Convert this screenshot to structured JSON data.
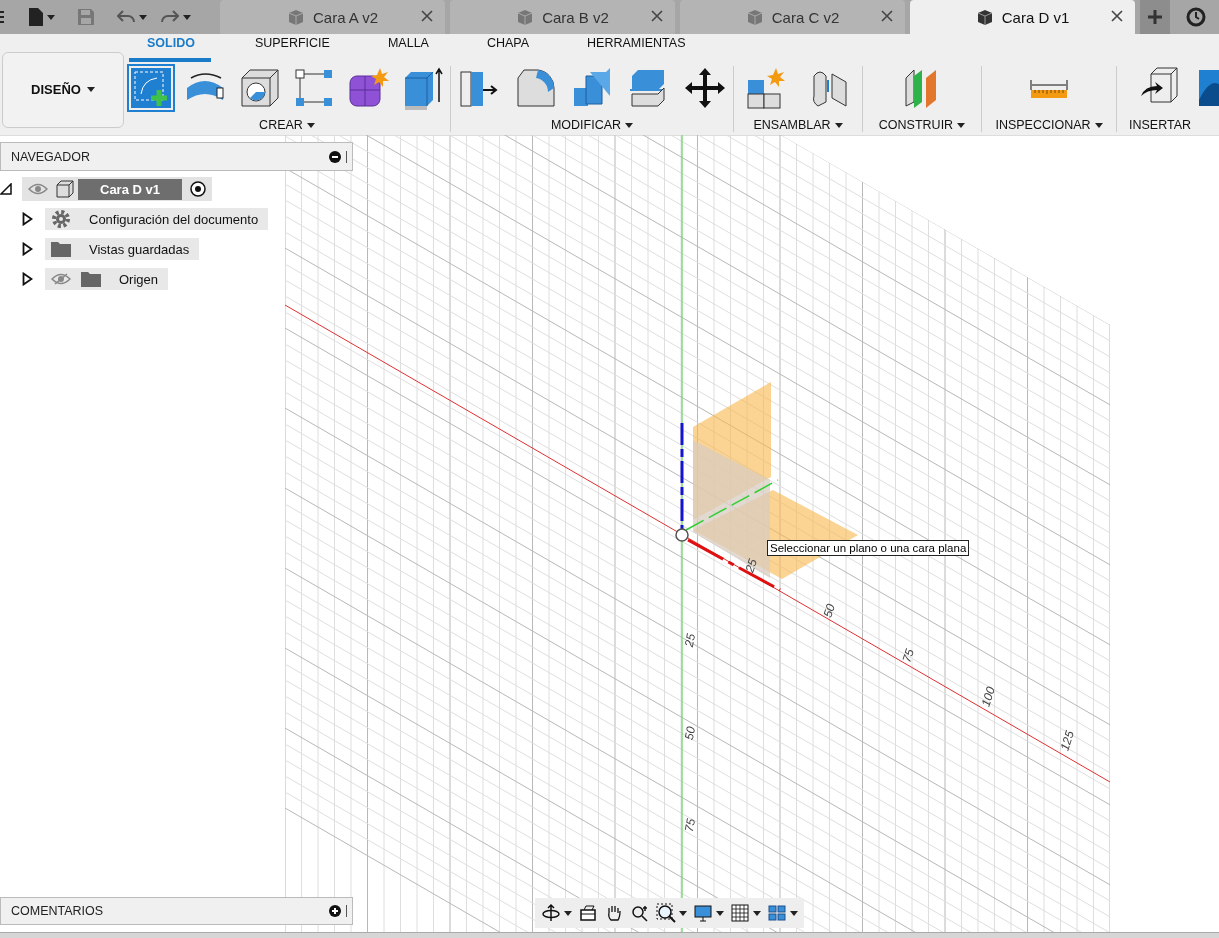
{
  "document_tabs": [
    {
      "title": "Cara A v2",
      "selected": false
    },
    {
      "title": "Cara B v2",
      "selected": false
    },
    {
      "title": "Cara C v2",
      "selected": false
    },
    {
      "title": "Cara D v1",
      "selected": true
    }
  ],
  "workspace_button": {
    "label": "DISEÑO"
  },
  "ribbon_tabs": [
    {
      "label": "SOLIDO",
      "selected": true
    },
    {
      "label": "SUPERFICIE",
      "selected": false
    },
    {
      "label": "MALLA",
      "selected": false
    },
    {
      "label": "CHAPA",
      "selected": false
    },
    {
      "label": "HERRAMIENTAS",
      "selected": false
    }
  ],
  "tool_groups": [
    {
      "label": "CREAR",
      "tools": [
        {
          "kind": "sketch",
          "selected": true
        },
        {
          "kind": "revolve",
          "selected": false
        },
        {
          "kind": "hole",
          "selected": false
        },
        {
          "kind": "pattern",
          "selected": false
        },
        {
          "kind": "form",
          "selected": false
        },
        {
          "kind": "extrude",
          "selected": false
        }
      ]
    },
    {
      "label": "MODIFICAR",
      "tools": [
        {
          "kind": "presspull",
          "selected": false
        },
        {
          "kind": "fillet",
          "selected": false
        },
        {
          "kind": "combine",
          "selected": false
        },
        {
          "kind": "split",
          "selected": false
        },
        {
          "kind": "move",
          "selected": false
        }
      ]
    },
    {
      "label": "ENSAMBLAR",
      "tools": [
        {
          "kind": "component",
          "selected": false
        },
        {
          "kind": "joint",
          "selected": false
        }
      ]
    },
    {
      "label": "CONSTRUIR",
      "tools": [
        {
          "kind": "plane",
          "selected": false
        }
      ]
    },
    {
      "label": "INSPECCIONAR",
      "tools": [
        {
          "kind": "measure",
          "selected": false
        }
      ]
    },
    {
      "label": "INSERTAR",
      "tools": [
        {
          "kind": "insert",
          "selected": false
        },
        {
          "kind": "canvas",
          "selected": false
        }
      ]
    }
  ],
  "navigator": {
    "title": "NAVEGADOR",
    "root": {
      "label": "Cara D v1",
      "expanded": true,
      "visible": true,
      "children": [
        {
          "label": "Configuración del documento",
          "kind": "settings",
          "expanded": false
        },
        {
          "label": "Vistas guardadas",
          "kind": "folder",
          "expanded": false
        },
        {
          "label": "Origen",
          "kind": "folder",
          "expanded": false,
          "visible": false
        }
      ]
    }
  },
  "viewport": {
    "x_axis_labels": [
      "25",
      "50",
      "75",
      "100",
      "125"
    ],
    "y_axis_labels": [
      "25",
      "50",
      "75"
    ],
    "tooltip": "Seleccionar un plano o una cara plana"
  },
  "comments_panel": {
    "title": "COMENTARIOS"
  },
  "view_toolbar": [
    {
      "kind": "orbit",
      "menu": true
    },
    {
      "kind": "look",
      "menu": false
    },
    {
      "kind": "pan",
      "menu": false
    },
    {
      "kind": "zoom",
      "menu": false
    },
    {
      "kind": "fit",
      "menu": true
    },
    {
      "kind": "display",
      "menu": true
    },
    {
      "kind": "grid",
      "menu": true
    },
    {
      "kind": "viewports",
      "menu": true
    }
  ]
}
